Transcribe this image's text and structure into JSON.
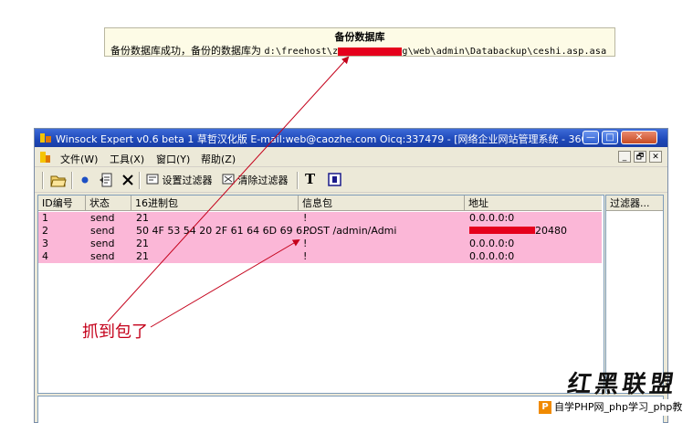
{
  "message": {
    "title": "备份数据库",
    "body_prefix": "备份数据库成功，备份的数据库为",
    "path_start": "d:\\freehost\\z",
    "path_mid": "g",
    "path_end": "\\web\\admin\\Databackup\\ceshi.asp.asa"
  },
  "window": {
    "title": "Winsock Expert v0.6 beta 1 草哲汉化版 E-mail:web@caozhe.com Oicq:337479 - [网络企业网站管理系统 - 360…",
    "minimize_glyph": "—",
    "maximize_glyph": "□",
    "close_glyph": "✕"
  },
  "menu": {
    "items": [
      "文件(W)",
      "工具(X)",
      "窗口(Y)",
      "帮助(Z)"
    ],
    "mdi_min": "_",
    "mdi_restore": "🗗",
    "mdi_close": "✕"
  },
  "toolbar": {
    "set_filter": "设置过滤器",
    "clear_filter": "清除过滤器",
    "text_tool": "T"
  },
  "table": {
    "columns": [
      "ID编号",
      "状态",
      "16进制包",
      "信息包",
      "地址"
    ],
    "rows": [
      {
        "id": "1",
        "status": "send",
        "hex": "21",
        "info": "!",
        "addr": "0.0.0.0:0"
      },
      {
        "id": "2",
        "status": "send",
        "hex": "50 4F 53 54 20 2F 61 64 6D 69 6…",
        "info": "POST /admin/Admi",
        "addr": "20480"
      },
      {
        "id": "3",
        "status": "send",
        "hex": "21",
        "info": "!",
        "addr": "0.0.0.0:0"
      },
      {
        "id": "4",
        "status": "send",
        "hex": "21",
        "info": "!",
        "addr": "0.0.0.0:0"
      }
    ]
  },
  "filter_pane": {
    "header": "过滤器..."
  },
  "annotation": {
    "caption": "抓到包了",
    "color": "#c4001a"
  },
  "watermark": {
    "logo": "红黑联盟",
    "php_icon": "P",
    "php_text": "自学PHP网_php学习_php教"
  },
  "colors": {
    "row_highlight": "#fbb7d7",
    "redaction": "#e5001c",
    "title_bar": "#1d47b8"
  }
}
